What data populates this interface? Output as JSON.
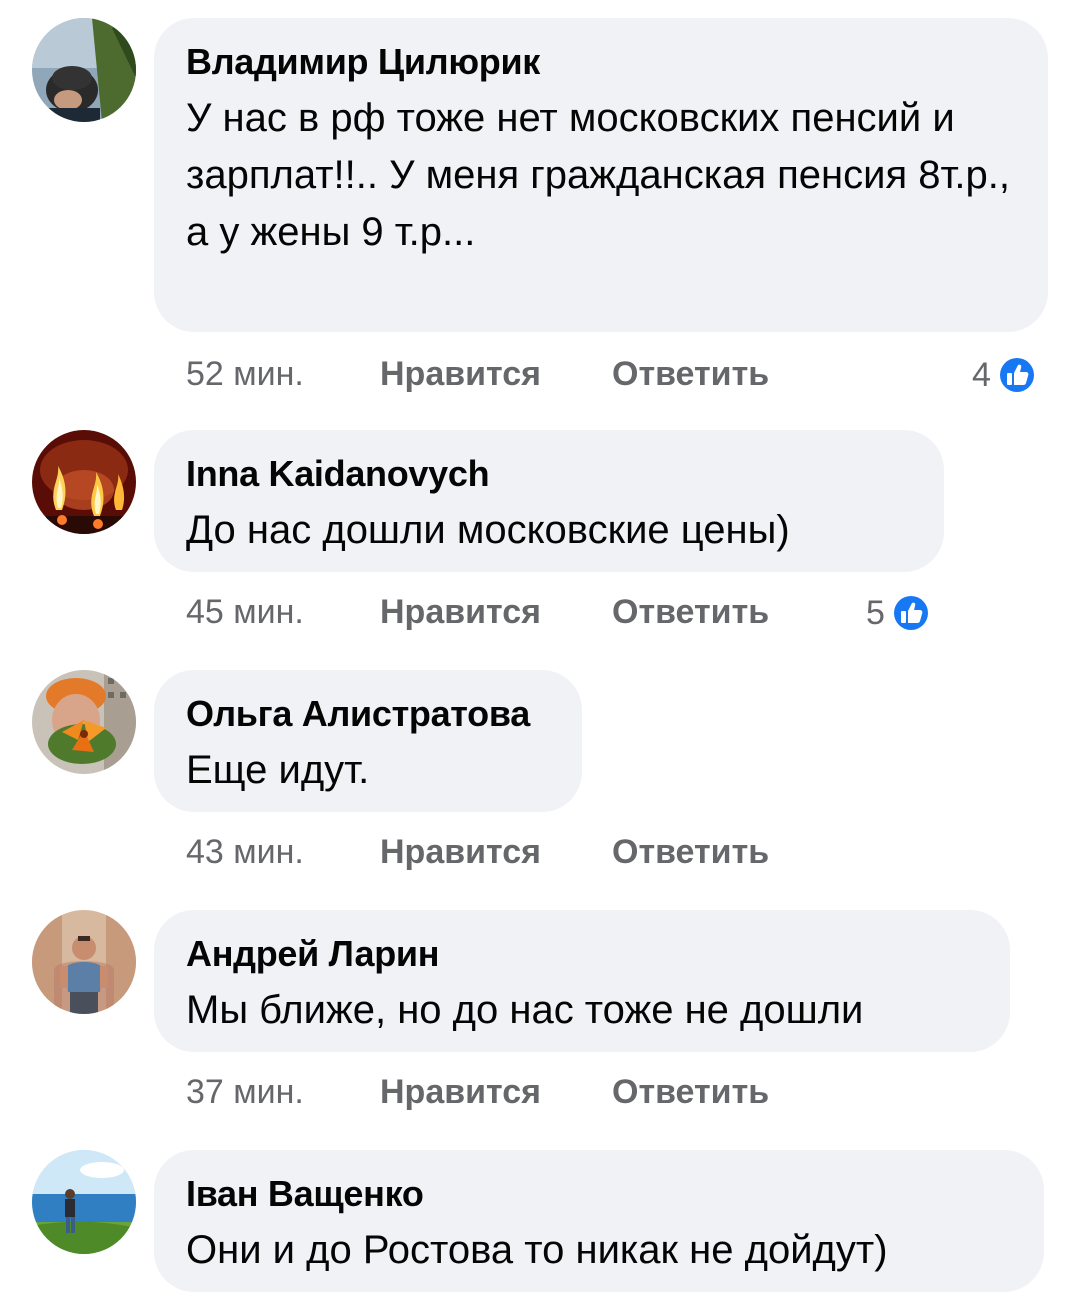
{
  "comments": [
    {
      "author": "Владимир Цилюрик",
      "text": "У нас в рф тоже нет московских пенсий и зарплат!!.. У меня гражданская пенсия 8т.р., а у жены 9 т.р...",
      "time": "52 мин.",
      "like_label": "Нравится",
      "reply_label": "Ответить",
      "reactions": "4"
    },
    {
      "author": "Inna Kaidanovych",
      "text": "До нас дошли московские цены)",
      "time": "45 мин.",
      "like_label": "Нравится",
      "reply_label": "Ответить",
      "reactions": "5"
    },
    {
      "author": "Ольга Алистратова",
      "text": "Еще идут.",
      "time": "43 мин.",
      "like_label": "Нравится",
      "reply_label": "Ответить",
      "reactions": ""
    },
    {
      "author": "Андрей Ларин",
      "text": "Мы ближе, но до нас тоже не дошли",
      "time": "37 мин.",
      "like_label": "Нравится",
      "reply_label": "Ответить",
      "reactions": ""
    },
    {
      "author": "Іван Ващенко",
      "text": "Они и до Ростова то никак не дойдут)",
      "time": "",
      "like_label": "",
      "reply_label": "",
      "reactions": ""
    }
  ],
  "colors": {
    "bubble": "#f0f2f5",
    "meta_text": "#65676b",
    "like_blue": "#1877f2"
  },
  "icons": {
    "reaction": "like-icon"
  }
}
